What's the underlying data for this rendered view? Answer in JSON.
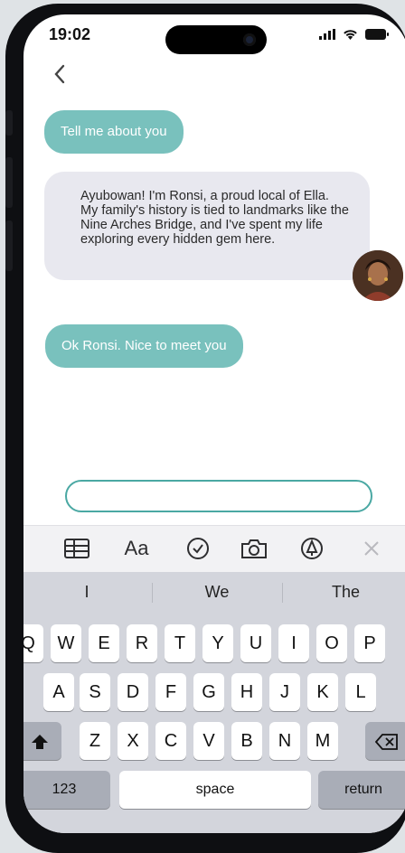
{
  "status": {
    "time": "19:02"
  },
  "chat": {
    "user_message_1": "Tell me about you",
    "bot_message": "Ayubowan! I'm Ronsi, a proud local of Ella. My family's history is tied to landmarks like the Nine Arches Bridge, and I've spent my life exploring every hidden gem here.",
    "user_message_2": "Ok Ronsi. Nice to meet you"
  },
  "input": {
    "value": ""
  },
  "keyboard": {
    "suggestions": [
      "I",
      "We",
      "The"
    ],
    "row1": [
      "Q",
      "W",
      "E",
      "R",
      "T",
      "Y",
      "U",
      "I",
      "O",
      "P"
    ],
    "row2": [
      "A",
      "S",
      "D",
      "F",
      "G",
      "H",
      "J",
      "K",
      "L"
    ],
    "row3": [
      "Z",
      "X",
      "C",
      "V",
      "B",
      "N",
      "M"
    ],
    "numbers_label": "123",
    "space_label": "space",
    "return_label": "return"
  },
  "toolbar": {
    "format_label": "Aa"
  },
  "colors": {
    "accent": "#79c1bd",
    "bot_bubble": "#e8e8ef",
    "input_border": "#4aa8a3"
  }
}
